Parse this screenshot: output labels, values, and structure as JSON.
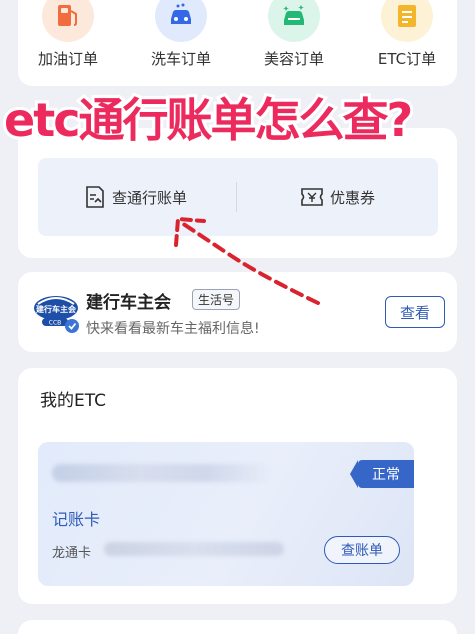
{
  "orders": [
    {
      "label": "加油订单",
      "icon": "fuel-pump-icon",
      "bg": "#fde8dc",
      "color": "#f26d3d"
    },
    {
      "label": "洗车订单",
      "icon": "car-wash-icon",
      "bg": "#e1eafd",
      "color": "#3468e6"
    },
    {
      "label": "美容订单",
      "icon": "car-beauty-icon",
      "bg": "#dcf5ea",
      "color": "#22b977"
    },
    {
      "label": "ETC订单",
      "icon": "etc-receipt-icon",
      "bg": "#fdf1d6",
      "color": "#f3b62a"
    }
  ],
  "overlay_title": "etc通行账单怎么查?",
  "bill": {
    "query_label": "查通行账单",
    "coupon_label": "优惠券"
  },
  "club": {
    "name": "建行车主会",
    "tag": "生活号",
    "desc": "快来看看最新车主福利信息!",
    "view_label": "查看",
    "logo_text": "建行车主会",
    "logo_sub": "CCB"
  },
  "etc": {
    "title": "我的ETC",
    "status": "正常",
    "card_type": "记账卡",
    "card_label": "龙通卡",
    "bill_label": "查账单"
  },
  "colors": {
    "accent": "#2f5bb7",
    "overlay_red": "#ec2a5d",
    "arrow_red": "#d9232e"
  }
}
